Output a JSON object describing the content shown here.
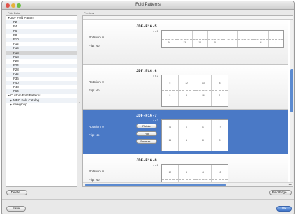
{
  "window": {
    "title": "Fold Patterns"
  },
  "headers": {
    "sidebar": "Fold Data",
    "preview": "Preview"
  },
  "tree": [
    {
      "label": "JDF Fold Pattern",
      "indent": 1,
      "expanded": true
    },
    {
      "label": "F2",
      "indent": 3
    },
    {
      "label": "F4",
      "indent": 3
    },
    {
      "label": "F6",
      "indent": 3
    },
    {
      "label": "F8",
      "indent": 3
    },
    {
      "label": "F10",
      "indent": 3
    },
    {
      "label": "F12",
      "indent": 3
    },
    {
      "label": "F14",
      "indent": 3
    },
    {
      "label": "F16",
      "indent": 3,
      "selected": true
    },
    {
      "label": "F18",
      "indent": 3
    },
    {
      "label": "F20",
      "indent": 3
    },
    {
      "label": "F24",
      "indent": 3
    },
    {
      "label": "F28",
      "indent": 3
    },
    {
      "label": "F32",
      "indent": 3
    },
    {
      "label": "F36",
      "indent": 3
    },
    {
      "label": "F40",
      "indent": 3
    },
    {
      "label": "F48",
      "indent": 3
    },
    {
      "label": "F64",
      "indent": 3
    },
    {
      "label": "Custom Fold Patterns",
      "indent": 1,
      "expanded": true
    },
    {
      "label": "MBO Fold Catalog",
      "indent": 2,
      "expanded": false
    },
    {
      "label": "newgroup",
      "indent": 2,
      "expanded": false
    }
  ],
  "patterns": [
    {
      "name": "JDF-F16-5",
      "dims": "4 x 2",
      "rotation": "Rotation: 0",
      "flip": "Flip: No",
      "cols": 8,
      "rows": 1,
      "pages": [
        "16",
        "13",
        "12",
        "5",
        "",
        "",
        "4",
        "1"
      ],
      "selected": false
    },
    {
      "name": "JDF-F16-6",
      "dims": "4 x 2",
      "rotation": "Rotation: 0",
      "flip": "Flip: No",
      "cols": 4,
      "rows": 2,
      "pages": [
        "5",
        "12",
        "13",
        "4",
        "8",
        "9",
        "16",
        "1"
      ],
      "selected": false
    },
    {
      "name": "JDF-F16-7",
      "dims": "4 x 2",
      "rotation": "Rotation: 0",
      "flip": "Flip: No",
      "cols": 4,
      "rows": 2,
      "pages": [
        "13",
        "4",
        "5",
        "12",
        "16",
        "1",
        "8",
        "9"
      ],
      "selected": true
    },
    {
      "name": "JDF-F16-8",
      "dims": "4 x 2",
      "rotation": "Rotation: 0",
      "flip": "Flip: No",
      "cols": 4,
      "rows": 2,
      "pages": [
        "12",
        "5",
        "4",
        "13",
        "9",
        "8",
        "1",
        "16"
      ],
      "selected": false
    }
  ],
  "context_buttons": {
    "rotate": "Rotate",
    "flip": "Flip",
    "save_as": "Save as..."
  },
  "buttons": {
    "delete": "Delete...",
    "bind_edge": "Bind Edge...",
    "save": "Save",
    "ok": "OK"
  },
  "colors": {
    "selection": "#4a79c6",
    "accent": "#3f74c9"
  }
}
